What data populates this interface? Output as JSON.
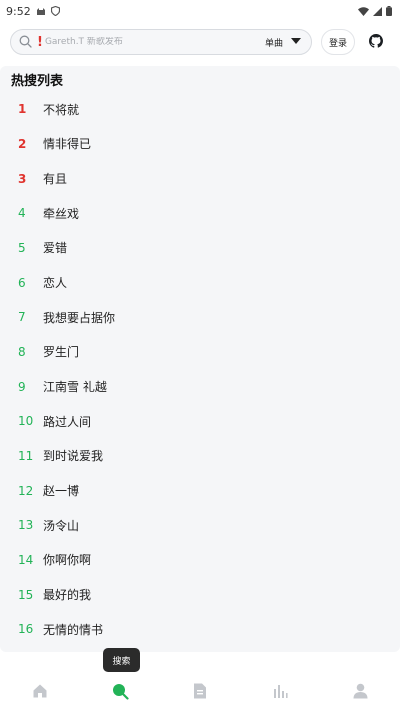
{
  "status_bar": {
    "time": "9:52"
  },
  "search": {
    "placeholder": "Gareth.T 新歌发布",
    "alert_mark": "!",
    "type_selected": "单曲"
  },
  "header": {
    "login_label": "登录"
  },
  "hot_search": {
    "title": "热搜列表",
    "items": [
      {
        "rank": "1",
        "word": "不将就"
      },
      {
        "rank": "2",
        "word": "情非得已"
      },
      {
        "rank": "3",
        "word": "有且"
      },
      {
        "rank": "4",
        "word": "牵丝戏"
      },
      {
        "rank": "5",
        "word": "爱错"
      },
      {
        "rank": "6",
        "word": "恋人"
      },
      {
        "rank": "7",
        "word": "我想要占据你"
      },
      {
        "rank": "8",
        "word": "罗生门"
      },
      {
        "rank": "9",
        "word": "江南雪 礼越"
      },
      {
        "rank": "10",
        "word": "路过人间"
      },
      {
        "rank": "11",
        "word": "到时说爱我"
      },
      {
        "rank": "12",
        "word": "赵一博"
      },
      {
        "rank": "13",
        "word": "汤令山"
      },
      {
        "rank": "14",
        "word": "你啊你啊"
      },
      {
        "rank": "15",
        "word": "最好的我"
      },
      {
        "rank": "16",
        "word": "无情的情书"
      }
    ]
  },
  "tooltip": {
    "text": "搜索"
  },
  "bottom_nav": [
    {
      "icon": "home-icon"
    },
    {
      "icon": "search-icon",
      "active": true
    },
    {
      "icon": "document-icon"
    },
    {
      "icon": "chart-icon"
    },
    {
      "icon": "user-icon"
    }
  ],
  "colors": {
    "top_rank": "#e0342f",
    "rank": "#22b357",
    "active_nav": "#22b357",
    "inactive_nav": "#c4c7cc"
  }
}
